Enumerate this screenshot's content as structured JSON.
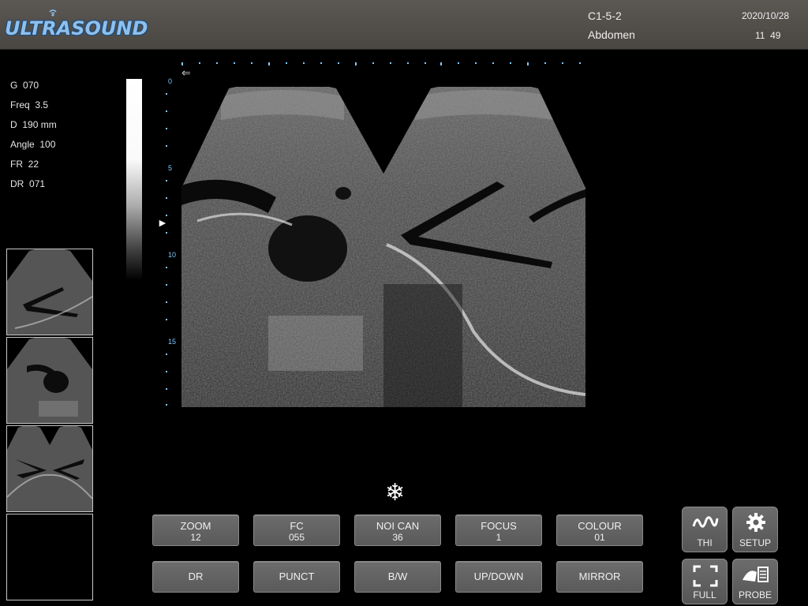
{
  "header": {
    "logo": "ULTRASOUND",
    "probe": "C1-5-2",
    "exam": "Abdomen",
    "date": "2020/10/28",
    "time": "11  49"
  },
  "params": [
    {
      "label": "G",
      "value": "070"
    },
    {
      "label": "Freq",
      "value": "3.5"
    },
    {
      "label": "D",
      "value": "190 mm"
    },
    {
      "label": "Angle",
      "value": "100"
    },
    {
      "label": "FR",
      "value": "22"
    },
    {
      "label": "DR",
      "value": "071"
    }
  ],
  "depth_scale": [
    "0",
    "5",
    "10",
    "15"
  ],
  "freeze_icon": "snowflake-icon",
  "buttons_row1": [
    {
      "label": "ZOOM",
      "value": "12"
    },
    {
      "label": "FC",
      "value": "055"
    },
    {
      "label": "NOI CAN",
      "value": "36"
    },
    {
      "label": "FOCUS",
      "value": "1"
    },
    {
      "label": "COLOUR",
      "value": "01"
    }
  ],
  "buttons_row2": [
    "DR",
    "PUNCT",
    "B/W",
    "UP/DOWN",
    "MIRROR"
  ],
  "side_buttons": [
    {
      "label": "THI",
      "icon": "wave-icon"
    },
    {
      "label": "SETUP",
      "icon": "gear-icon"
    },
    {
      "label": "FULL",
      "icon": "fullscreen-icon"
    },
    {
      "label": "PROBE",
      "icon": "probe-icon"
    }
  ],
  "colors": {
    "accent": "#7fc8ff",
    "logo": "#8fc0ec",
    "header": "#524e4a"
  }
}
